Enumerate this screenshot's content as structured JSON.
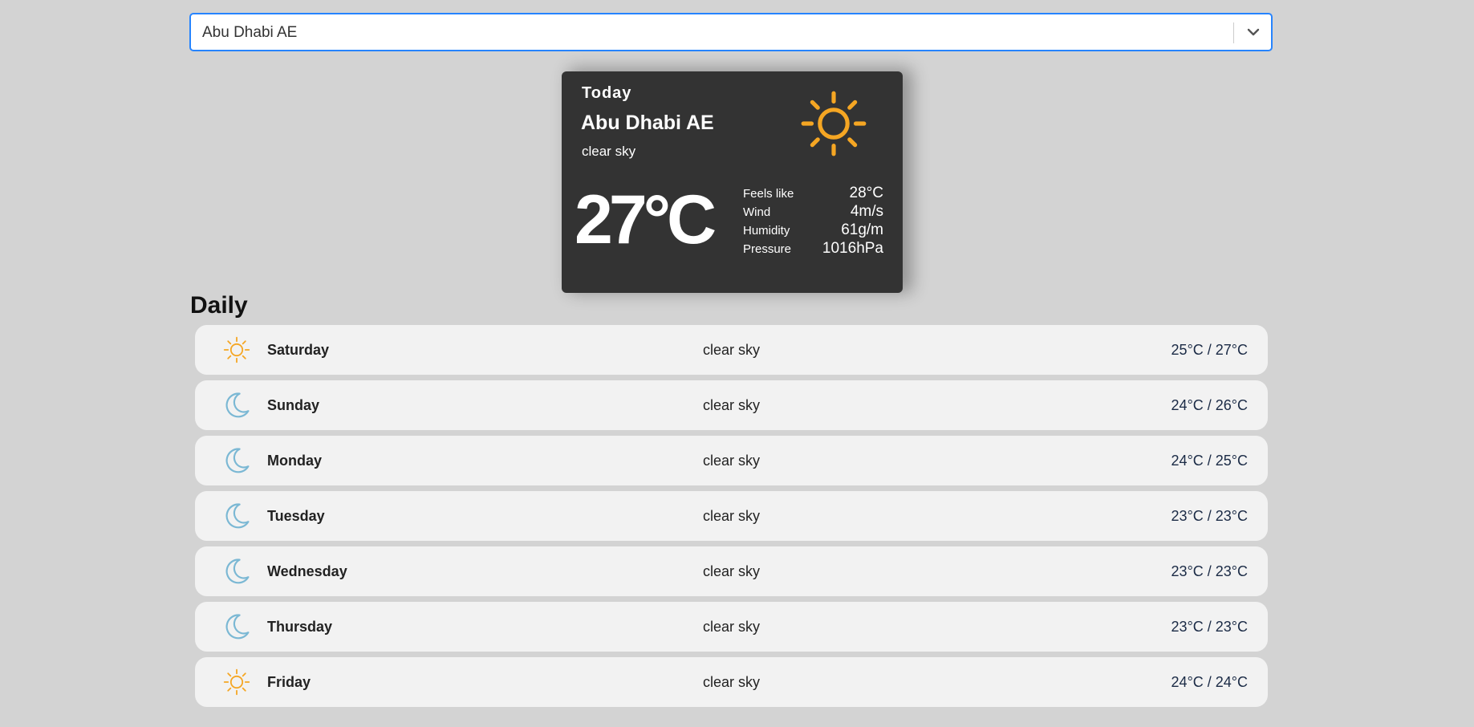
{
  "search": {
    "value": "Abu Dhabi AE"
  },
  "current": {
    "heading": "Today",
    "city": "Abu Dhabi AE",
    "description": "clear sky",
    "temperature": "27°C",
    "icon": "sun-icon",
    "details": [
      {
        "label": "Feels like",
        "value": "28°C"
      },
      {
        "label": "Wind",
        "value": "4m/s"
      },
      {
        "label": "Humidity",
        "value": "61g/m"
      },
      {
        "label": "Pressure",
        "value": "1016hPa"
      }
    ]
  },
  "daily": {
    "title": "Daily",
    "days": [
      {
        "name": "Saturday",
        "description": "clear sky",
        "range": "25°C / 27°C",
        "icon": "sun-icon"
      },
      {
        "name": "Sunday",
        "description": "clear sky",
        "range": "24°C / 26°C",
        "icon": "moon-icon"
      },
      {
        "name": "Monday",
        "description": "clear sky",
        "range": "24°C / 25°C",
        "icon": "moon-icon"
      },
      {
        "name": "Tuesday",
        "description": "clear sky",
        "range": "23°C / 23°C",
        "icon": "moon-icon"
      },
      {
        "name": "Wednesday",
        "description": "clear sky",
        "range": "23°C / 23°C",
        "icon": "moon-icon"
      },
      {
        "name": "Thursday",
        "description": "clear sky",
        "range": "23°C / 23°C",
        "icon": "moon-icon"
      },
      {
        "name": "Friday",
        "description": "clear sky",
        "range": "24°C / 24°C",
        "icon": "sun-icon"
      }
    ]
  },
  "colors": {
    "background": "#d3d3d3",
    "card": "#333333",
    "sun": "#f5a623",
    "moon": "#7bb8d4",
    "focus_border": "#2684ff"
  }
}
